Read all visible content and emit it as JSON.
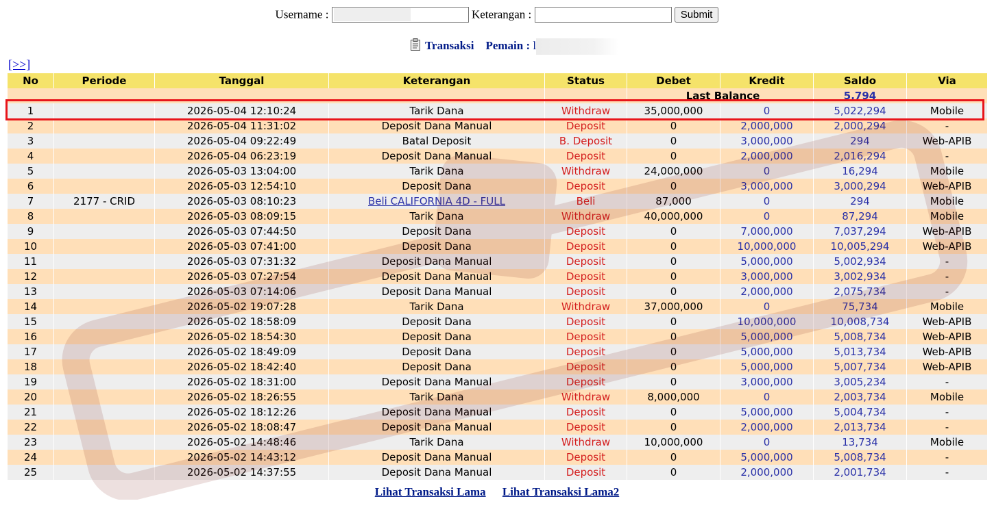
{
  "form": {
    "username_label": "Username :",
    "keterangan_label": "Keterangan :",
    "submit_label": "Submit"
  },
  "title": {
    "transaksi": "Transaksi",
    "pemain": "Pemain :",
    "player_initial": "l"
  },
  "nav": {
    "next_label": "[>>]"
  },
  "table": {
    "headers": [
      "No",
      "Periode",
      "Tanggal",
      "Keterangan",
      "Status",
      "Debet",
      "Kredit",
      "Saldo",
      "Via"
    ],
    "last_balance_label": "Last Balance",
    "last_balance_value": "5,794",
    "rows": [
      {
        "no": "1",
        "periode": "",
        "tanggal": "2026-05-04 12:10:24",
        "keterangan": "Tarik Dana",
        "status": "Withdraw",
        "debet": "35,000,000",
        "kredit": "0",
        "saldo": "5,022,294",
        "via": "Mobile"
      },
      {
        "no": "2",
        "periode": "",
        "tanggal": "2026-05-04 11:31:02",
        "keterangan": "Deposit Dana Manual",
        "status": "Deposit",
        "debet": "0",
        "kredit": "2,000,000",
        "saldo": "2,000,294",
        "via": "-"
      },
      {
        "no": "3",
        "periode": "",
        "tanggal": "2026-05-04 09:22:49",
        "keterangan": "Batal Deposit",
        "status": "B. Deposit",
        "debet": "0",
        "kredit": "3,000,000",
        "saldo": "294",
        "via": "Web-APIB"
      },
      {
        "no": "4",
        "periode": "",
        "tanggal": "2026-05-04 06:23:19",
        "keterangan": "Deposit Dana Manual",
        "status": "Deposit",
        "debet": "0",
        "kredit": "2,000,000",
        "saldo": "2,016,294",
        "via": "-"
      },
      {
        "no": "5",
        "periode": "",
        "tanggal": "2026-05-03 13:04:00",
        "keterangan": "Tarik Dana",
        "status": "Withdraw",
        "debet": "24,000,000",
        "kredit": "0",
        "saldo": "16,294",
        "via": "Mobile"
      },
      {
        "no": "6",
        "periode": "",
        "tanggal": "2026-05-03 12:54:10",
        "keterangan": "Deposit Dana",
        "status": "Deposit",
        "debet": "0",
        "kredit": "3,000,000",
        "saldo": "3,000,294",
        "via": "Web-APIB"
      },
      {
        "no": "7",
        "periode": "2177 - CRID",
        "tanggal": "2026-05-03 08:10:23",
        "keterangan": "Beli CALIFORNIA 4D - FULL",
        "status": "Beli",
        "debet": "87,000",
        "kredit": "0",
        "saldo": "294",
        "via": "Mobile",
        "link": true
      },
      {
        "no": "8",
        "periode": "",
        "tanggal": "2026-05-03 08:09:15",
        "keterangan": "Tarik Dana",
        "status": "Withdraw",
        "debet": "40,000,000",
        "kredit": "0",
        "saldo": "87,294",
        "via": "Mobile"
      },
      {
        "no": "9",
        "periode": "",
        "tanggal": "2026-05-03 07:44:50",
        "keterangan": "Deposit Dana",
        "status": "Deposit",
        "debet": "0",
        "kredit": "7,000,000",
        "saldo": "7,037,294",
        "via": "Web-APIB"
      },
      {
        "no": "10",
        "periode": "",
        "tanggal": "2026-05-03 07:41:00",
        "keterangan": "Deposit Dana",
        "status": "Deposit",
        "debet": "0",
        "kredit": "10,000,000",
        "saldo": "10,005,294",
        "via": "Web-APIB"
      },
      {
        "no": "11",
        "periode": "",
        "tanggal": "2026-05-03 07:31:32",
        "keterangan": "Deposit Dana Manual",
        "status": "Deposit",
        "debet": "0",
        "kredit": "5,000,000",
        "saldo": "5,002,934",
        "via": "-"
      },
      {
        "no": "12",
        "periode": "",
        "tanggal": "2026-05-03 07:27:54",
        "keterangan": "Deposit Dana Manual",
        "status": "Deposit",
        "debet": "0",
        "kredit": "3,000,000",
        "saldo": "3,002,934",
        "via": "-"
      },
      {
        "no": "13",
        "periode": "",
        "tanggal": "2026-05-03 07:14:06",
        "keterangan": "Deposit Dana Manual",
        "status": "Deposit",
        "debet": "0",
        "kredit": "2,000,000",
        "saldo": "2,075,734",
        "via": "-"
      },
      {
        "no": "14",
        "periode": "",
        "tanggal": "2026-05-02 19:07:28",
        "keterangan": "Tarik Dana",
        "status": "Withdraw",
        "debet": "37,000,000",
        "kredit": "0",
        "saldo": "75,734",
        "via": "Mobile"
      },
      {
        "no": "15",
        "periode": "",
        "tanggal": "2026-05-02 18:58:09",
        "keterangan": "Deposit Dana",
        "status": "Deposit",
        "debet": "0",
        "kredit": "10,000,000",
        "saldo": "10,008,734",
        "via": "Web-APIB"
      },
      {
        "no": "16",
        "periode": "",
        "tanggal": "2026-05-02 18:54:30",
        "keterangan": "Deposit Dana",
        "status": "Deposit",
        "debet": "0",
        "kredit": "5,000,000",
        "saldo": "5,008,734",
        "via": "Web-APIB"
      },
      {
        "no": "17",
        "periode": "",
        "tanggal": "2026-05-02 18:49:09",
        "keterangan": "Deposit Dana",
        "status": "Deposit",
        "debet": "0",
        "kredit": "5,000,000",
        "saldo": "5,013,734",
        "via": "Web-APIB"
      },
      {
        "no": "18",
        "periode": "",
        "tanggal": "2026-05-02 18:42:40",
        "keterangan": "Deposit Dana",
        "status": "Deposit",
        "debet": "0",
        "kredit": "5,000,000",
        "saldo": "5,007,734",
        "via": "Web-APIB"
      },
      {
        "no": "19",
        "periode": "",
        "tanggal": "2026-05-02 18:31:00",
        "keterangan": "Deposit Dana Manual",
        "status": "Deposit",
        "debet": "0",
        "kredit": "3,000,000",
        "saldo": "3,005,234",
        "via": "-"
      },
      {
        "no": "20",
        "periode": "",
        "tanggal": "2026-05-02 18:26:55",
        "keterangan": "Tarik Dana",
        "status": "Withdraw",
        "debet": "8,000,000",
        "kredit": "0",
        "saldo": "2,003,734",
        "via": "Mobile"
      },
      {
        "no": "21",
        "periode": "",
        "tanggal": "2026-05-02 18:12:26",
        "keterangan": "Deposit Dana Manual",
        "status": "Deposit",
        "debet": "0",
        "kredit": "5,000,000",
        "saldo": "5,004,734",
        "via": "-"
      },
      {
        "no": "22",
        "periode": "",
        "tanggal": "2026-05-02 18:08:47",
        "keterangan": "Deposit Dana Manual",
        "status": "Deposit",
        "debet": "0",
        "kredit": "2,000,000",
        "saldo": "2,013,734",
        "via": "-"
      },
      {
        "no": "23",
        "periode": "",
        "tanggal": "2026-05-02 14:48:46",
        "keterangan": "Tarik Dana",
        "status": "Withdraw",
        "debet": "10,000,000",
        "kredit": "0",
        "saldo": "13,734",
        "via": "Mobile"
      },
      {
        "no": "24",
        "periode": "",
        "tanggal": "2026-05-02 14:43:12",
        "keterangan": "Deposit Dana Manual",
        "status": "Deposit",
        "debet": "0",
        "kredit": "5,000,000",
        "saldo": "5,008,734",
        "via": "-"
      },
      {
        "no": "25",
        "periode": "",
        "tanggal": "2026-05-02 14:37:55",
        "keterangan": "Deposit Dana Manual",
        "status": "Deposit",
        "debet": "0",
        "kredit": "2,000,000",
        "saldo": "2,001,734",
        "via": "-"
      }
    ]
  },
  "footer": {
    "old_transactions_label": "Lihat Transaksi Lama",
    "old_transactions2_label": "Lihat Transaksi Lama2"
  },
  "colors": {
    "header_bg": "#f5e36a",
    "row_odd_bg": "#eeeeee",
    "row_even_bg": "#ffdfb8",
    "status_red": "#d41e1e",
    "amount_blue": "#2a31a8",
    "highlight_red": "#e8141a"
  },
  "icons": {
    "title_icon": "clipboard-icon"
  }
}
